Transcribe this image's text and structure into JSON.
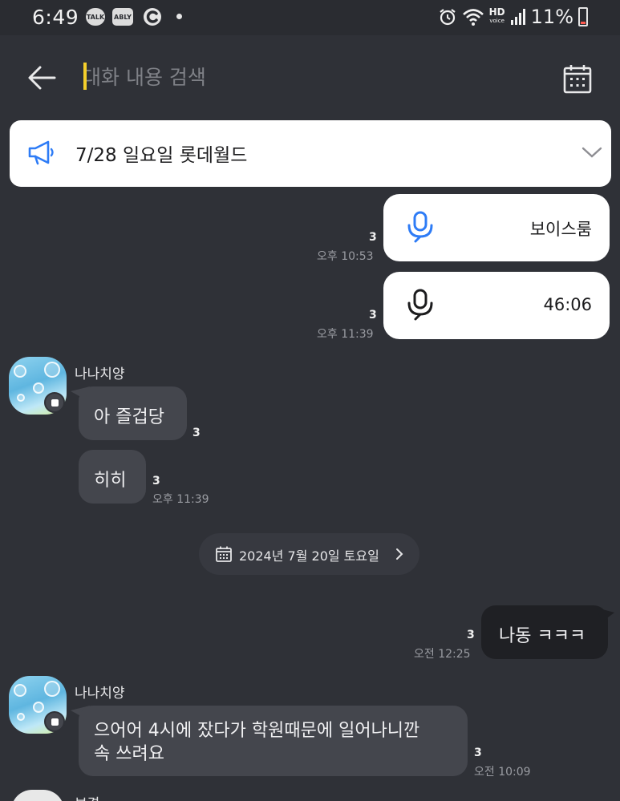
{
  "status_bar": {
    "time": "6:49",
    "app_talk": "TALK",
    "app_ably": "ABLY",
    "network": "HD",
    "network_sub": "voice",
    "battery": "11%"
  },
  "search": {
    "placeholder": "대화 내용 검색"
  },
  "notice": {
    "text": "7/28 일요일 롯데월드"
  },
  "messages": {
    "voiceroom": {
      "title": "보이스룸",
      "unread": "3",
      "time": "오후 10:53"
    },
    "voicecall": {
      "title": "46:06",
      "unread": "3",
      "time": "오후 11:39"
    },
    "group1": {
      "sender": "나나치양",
      "msg1": "아 즐겁당",
      "msg1_unread": "3",
      "msg2": "히히",
      "msg2_unread": "3",
      "msg2_time": "오후 11:39"
    },
    "date_divider": "2024년 7월 20일 토요일",
    "sent1": {
      "text": "나동 ㅋㅋㅋ",
      "unread": "3",
      "time": "오전 12:25"
    },
    "group2": {
      "sender": "나나치양",
      "msg_line1": "으어어 4시에 잤다가 학원때문에 일어나니깐",
      "msg_line2": "속 쓰려요",
      "unread": "3",
      "time": "오전 10:09"
    },
    "partial_sender": "보경"
  },
  "colors": {
    "background": "#2f3137",
    "bubble_received": "#44464d",
    "bubble_sent": "#1f2024",
    "voice_blue": "#2e7cf6",
    "caret_yellow": "#f5cf2b"
  }
}
